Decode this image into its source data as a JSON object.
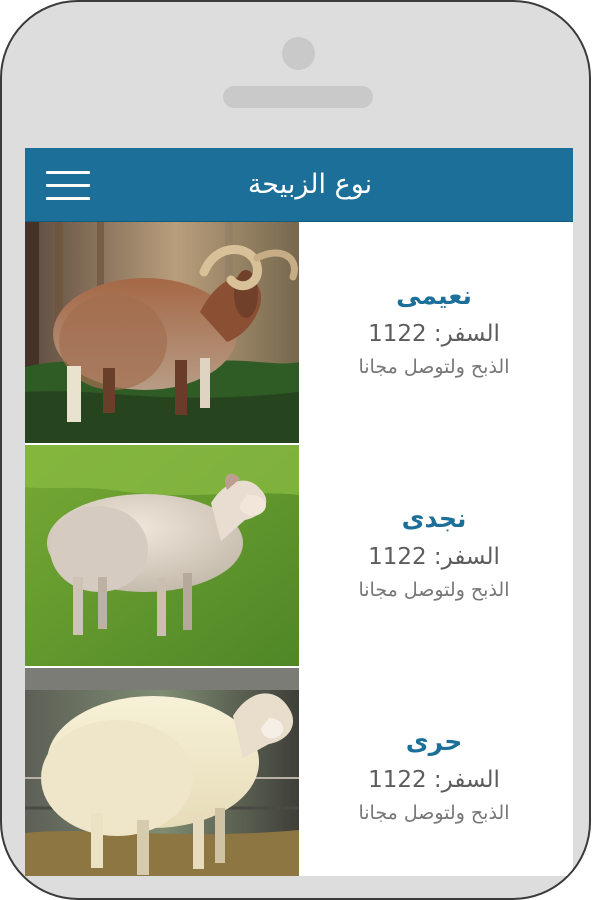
{
  "header": {
    "title": "نوع الزبيحة",
    "menu_icon": "hamburger-menu-icon"
  },
  "items": [
    {
      "name": "نعيمى",
      "price_text": "السفر: 1122",
      "note": "الذبح ولتوصل مجانا"
    },
    {
      "name": "نجدى",
      "price_text": "السفر: 1122",
      "note": "الذبح ولتوصل مجانا"
    },
    {
      "name": "حرى",
      "price_text": "السفر: 1122",
      "note": "الذبح ولتوصل مجانا"
    }
  ],
  "colors": {
    "header": "#1c6f98",
    "accent": "#1c6f98",
    "device_body": "#dddddd",
    "text_secondary": "#5c5c5c"
  }
}
